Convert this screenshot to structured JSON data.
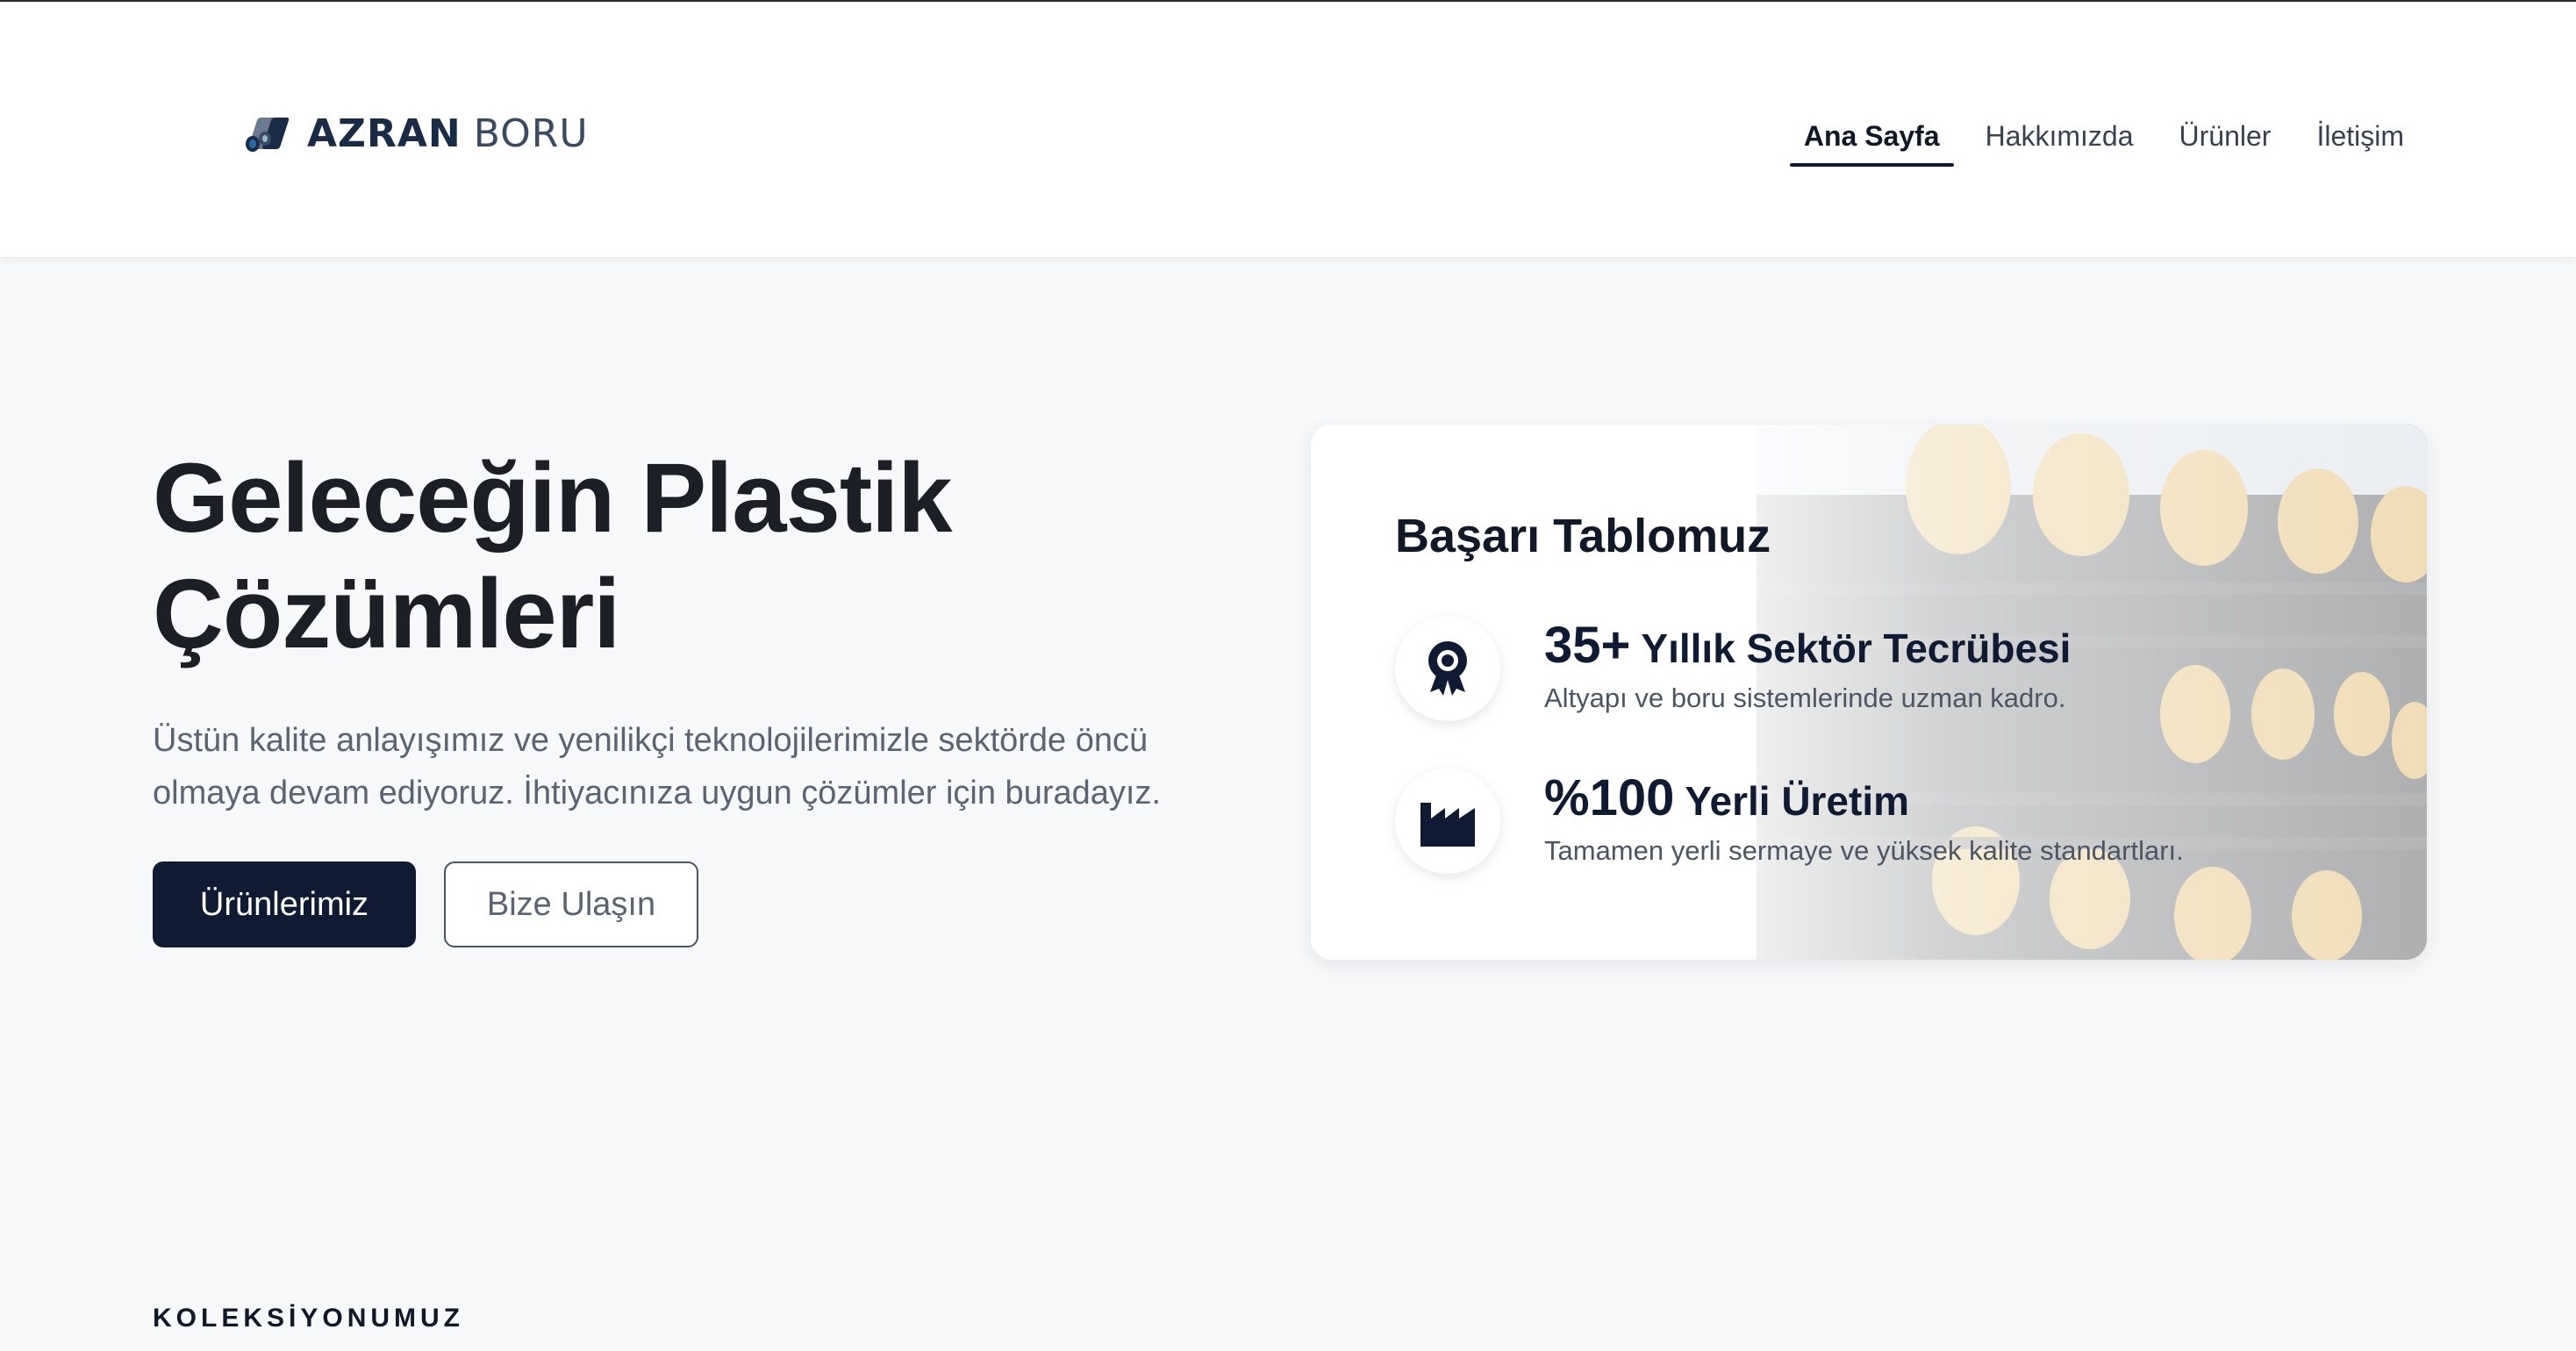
{
  "brand": {
    "name_bold": "AZRAN",
    "name_light": "BORU",
    "colors": {
      "navy": "#0f1b33",
      "accent_blue": "#2b6cb0"
    }
  },
  "nav": {
    "items": [
      {
        "label": "Ana Sayfa",
        "active": true
      },
      {
        "label": "Hakkımızda",
        "active": false
      },
      {
        "label": "Ürünler",
        "active": false
      },
      {
        "label": "İletişim",
        "active": false
      }
    ]
  },
  "hero": {
    "title_line1": "Geleceğin Plastik",
    "title_line2": "Çözümleri",
    "subtitle": "Üstün kalite anlayışımız ve yenilikçi teknolojilerimizle sektörde öncü olmaya devam ediyoruz. İhtiyacınıza uygun çözümler için buradayız.",
    "primary_button": "Ürünlerimiz",
    "secondary_button": "Bize Ulaşın"
  },
  "success_card": {
    "title": "Başarı Tablomuz",
    "stats": [
      {
        "icon": "award-ribbon-icon",
        "number": "35+",
        "label": "Yıllık Sektör Tecrübesi",
        "description": "Altyapı ve boru sistemlerinde uzman kadro."
      },
      {
        "icon": "factory-icon",
        "number": "%100",
        "label": "Yerli Üretim",
        "description": "Tamamen yerli sermaye ve yüksek kalite standartları."
      }
    ]
  },
  "collection": {
    "label": "KOLEKSİYONUMUZ"
  }
}
